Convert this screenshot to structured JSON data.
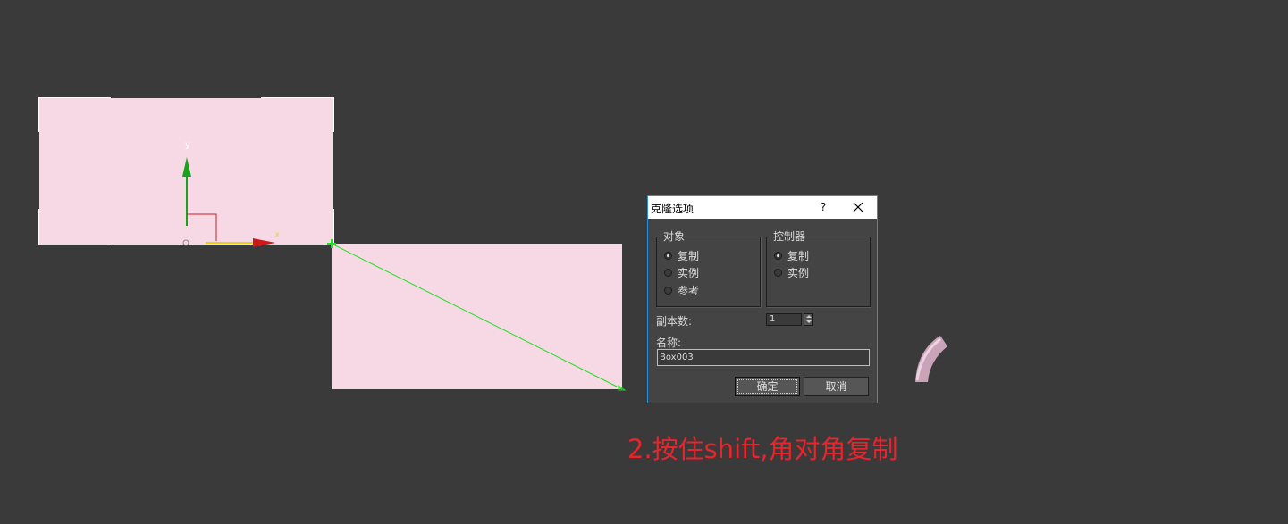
{
  "viewport": {
    "background": "#3a3a3a",
    "box_fill": "#f7d9e6",
    "snap_line_color": "#22dd22",
    "gizmo_y_label": "y",
    "gizmo_x_label": "x"
  },
  "dialog": {
    "title": "克隆选项",
    "help_label": "?",
    "object_group": {
      "label": "对象",
      "options": [
        "复制",
        "实例",
        "参考"
      ],
      "selected": "复制"
    },
    "controller_group": {
      "label": "控制器",
      "options": [
        "复制",
        "实例"
      ],
      "selected": "复制"
    },
    "copies_label": "副本数:",
    "copies_value": "1",
    "name_label": "名称:",
    "name_value": "Box003",
    "ok_label": "确定",
    "cancel_label": "取消"
  },
  "caption": {
    "text": "2.按住shift,角对角复制",
    "color": "#e8242c"
  }
}
